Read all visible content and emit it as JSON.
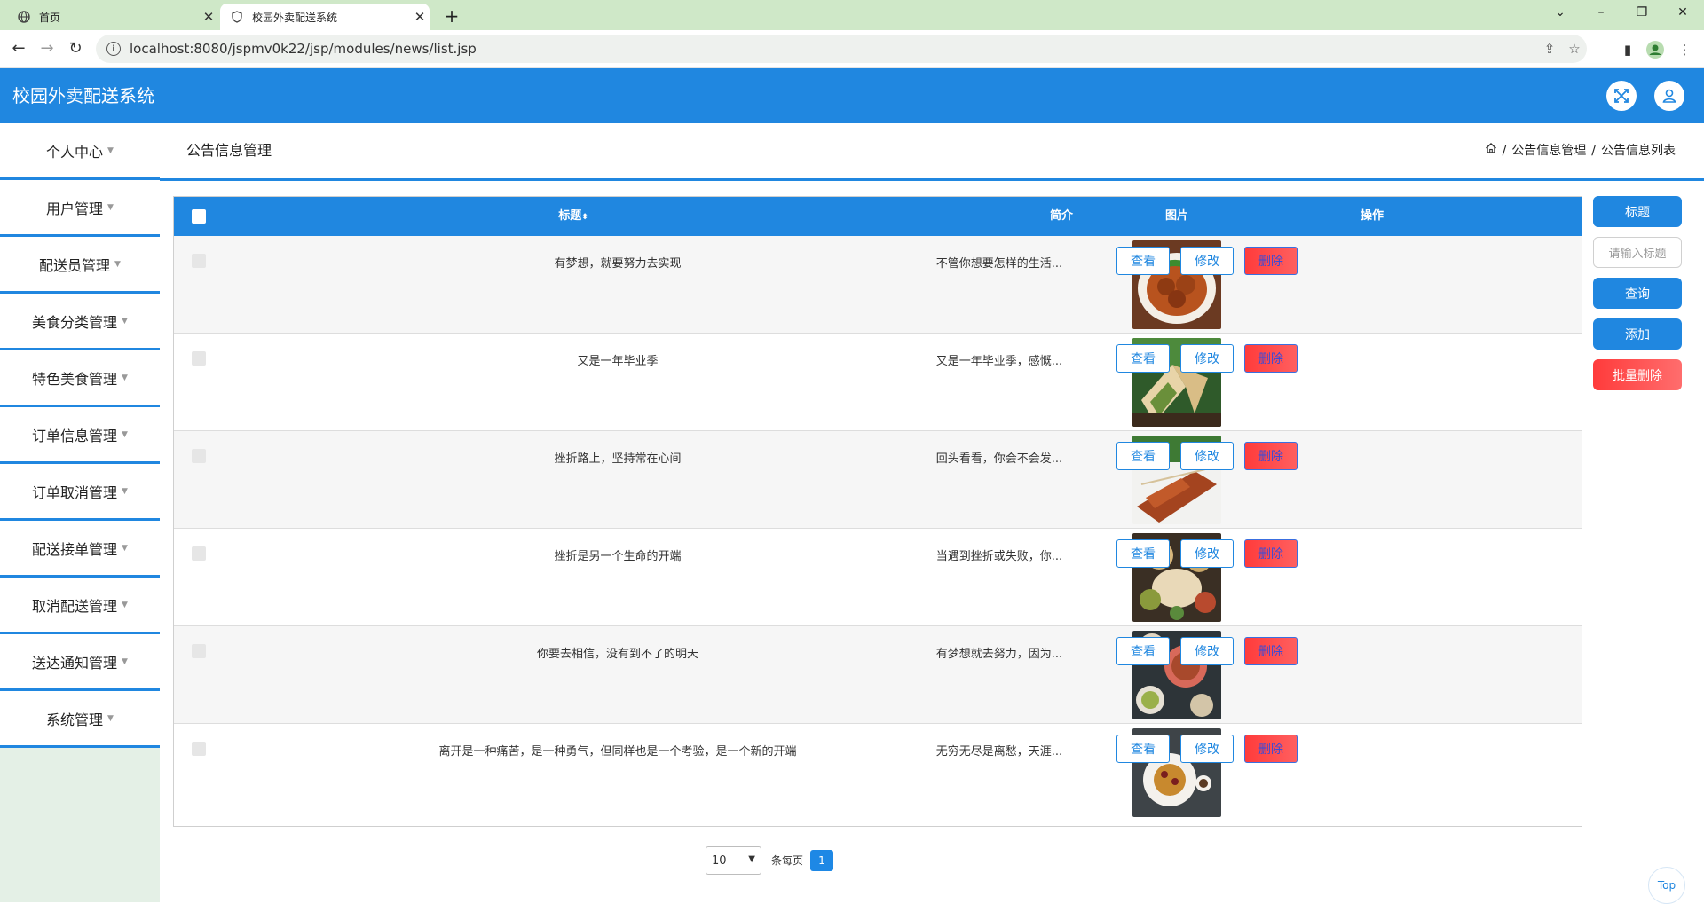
{
  "browser": {
    "tabs": [
      {
        "title": "首页",
        "active": false
      },
      {
        "title": "校园外卖配送系统",
        "active": true
      }
    ],
    "url": "localhost:8080/jspmv0k22/jsp/modules/news/list.jsp",
    "new_tab": "+"
  },
  "app": {
    "title": "校园外卖配送系统"
  },
  "sidebar": {
    "items": [
      {
        "label": "个人中心"
      },
      {
        "label": "用户管理"
      },
      {
        "label": "配送员管理"
      },
      {
        "label": "美食分类管理"
      },
      {
        "label": "特色美食管理"
      },
      {
        "label": "订单信息管理"
      },
      {
        "label": "订单取消管理"
      },
      {
        "label": "配送接单管理"
      },
      {
        "label": "取消配送管理"
      },
      {
        "label": "送达通知管理"
      },
      {
        "label": "系统管理"
      }
    ]
  },
  "breadcrumb": {
    "page_title": "公告信息管理",
    "sep": "/",
    "level1": "公告信息管理",
    "level2": "公告信息列表"
  },
  "table": {
    "headers": {
      "title": "标题",
      "intro": "简介",
      "image": "图片",
      "actions": "操作"
    },
    "rows": [
      {
        "title": "有梦想，就要努力去实现",
        "intro": "不管你想要怎样的生活...",
        "image": "dish-meatballs"
      },
      {
        "title": "又是一年毕业季",
        "intro": "又是一年毕业季，感慨...",
        "image": "dish-wraps"
      },
      {
        "title": "挫折路上，坚持常在心间",
        "intro": "回头看看，你会不会发...",
        "image": "dish-skewers"
      },
      {
        "title": "挫折是另一个生命的开端",
        "intro": "当遇到挫折或失败，你...",
        "image": "dish-platter"
      },
      {
        "title": "你要去相信，没有到不了的明天",
        "intro": "有梦想就去努力，因为...",
        "image": "dish-bowls"
      },
      {
        "title": "离开是一种痛苦，是一种勇气，但同样也是一个考验，是一个新的开端",
        "intro": "无穷无尽是离愁，天涯...",
        "image": "dish-waffle"
      }
    ],
    "actions": {
      "view": "查看",
      "edit": "修改",
      "delete": "删除"
    }
  },
  "search_panel": {
    "field_label": "标题",
    "placeholder": "请输入标题",
    "query": "查询",
    "add": "添加",
    "batch_delete": "批量删除"
  },
  "pagination": {
    "page_size": "10",
    "per_page_text": "条每页",
    "current_page": "1"
  },
  "to_top": "Top",
  "colors": {
    "primary": "#2087e0",
    "danger": "#ff4d4d",
    "tabbar": "#cfe8c8",
    "sidebar_bg": "#e4f0e6"
  }
}
